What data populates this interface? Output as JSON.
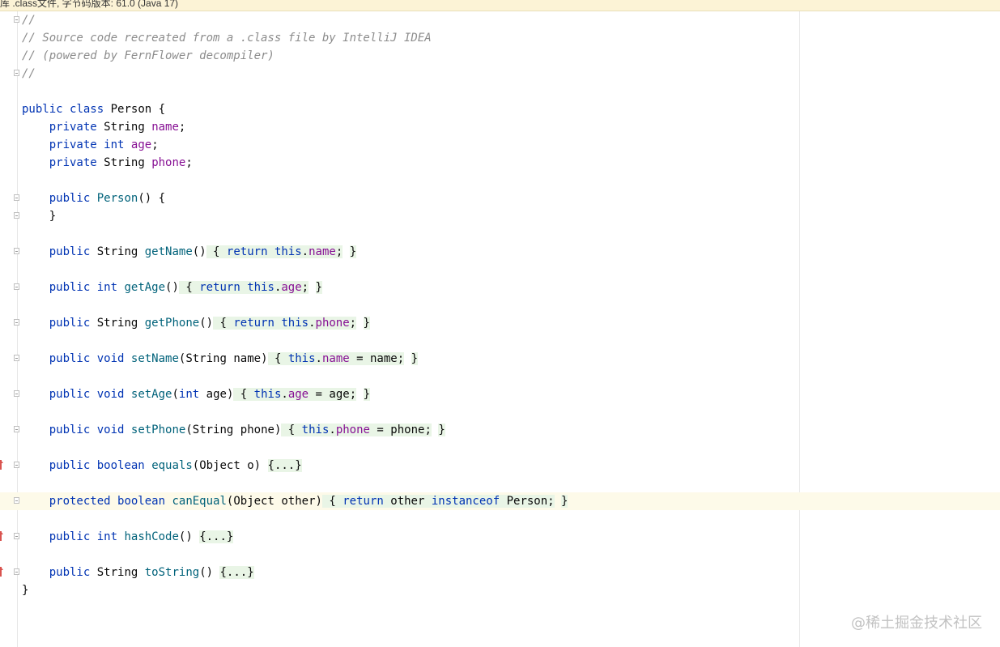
{
  "banner": {
    "text": "库 .class文件, 字节码版本: 61.0 (Java 17)"
  },
  "code": {
    "comment1": "//",
    "comment2": "// Source code recreated from a .class file by IntelliJ IDEA",
    "comment3": "// (powered by FernFlower decompiler)",
    "comment4": "//",
    "kw_public": "public",
    "kw_private": "private",
    "kw_protected": "protected",
    "kw_class": "class",
    "kw_return": "return",
    "kw_this": "this",
    "kw_int": "int",
    "kw_void": "void",
    "kw_boolean": "boolean",
    "kw_instanceof": "instanceof",
    "type_string": "String",
    "type_object": "Object",
    "class_name": "Person",
    "field_name": "name",
    "field_age": "age",
    "field_phone": "phone",
    "m_getName": "getName",
    "m_getAge": "getAge",
    "m_getPhone": "getPhone",
    "m_setName": "setName",
    "m_setAge": "setAge",
    "m_setPhone": "setPhone",
    "m_equals": "equals",
    "m_canEqual": "canEqual",
    "m_hashCode": "hashCode",
    "m_toString": "toString",
    "folded": "{...}",
    "param_o": "o",
    "param_other": "other",
    "close_brace": "}"
  },
  "watermark": {
    "text": "@稀土掘金技术社区"
  },
  "colors": {
    "keyword": "#0033b3",
    "field": "#871094",
    "method": "#00627a",
    "comment": "#8c8c8c",
    "fold_bg": "#e9f5e6",
    "caret_row": "#fdfae9"
  },
  "icons": {
    "fold": "fold-marker-icon",
    "override": "override-arrow-icon"
  }
}
